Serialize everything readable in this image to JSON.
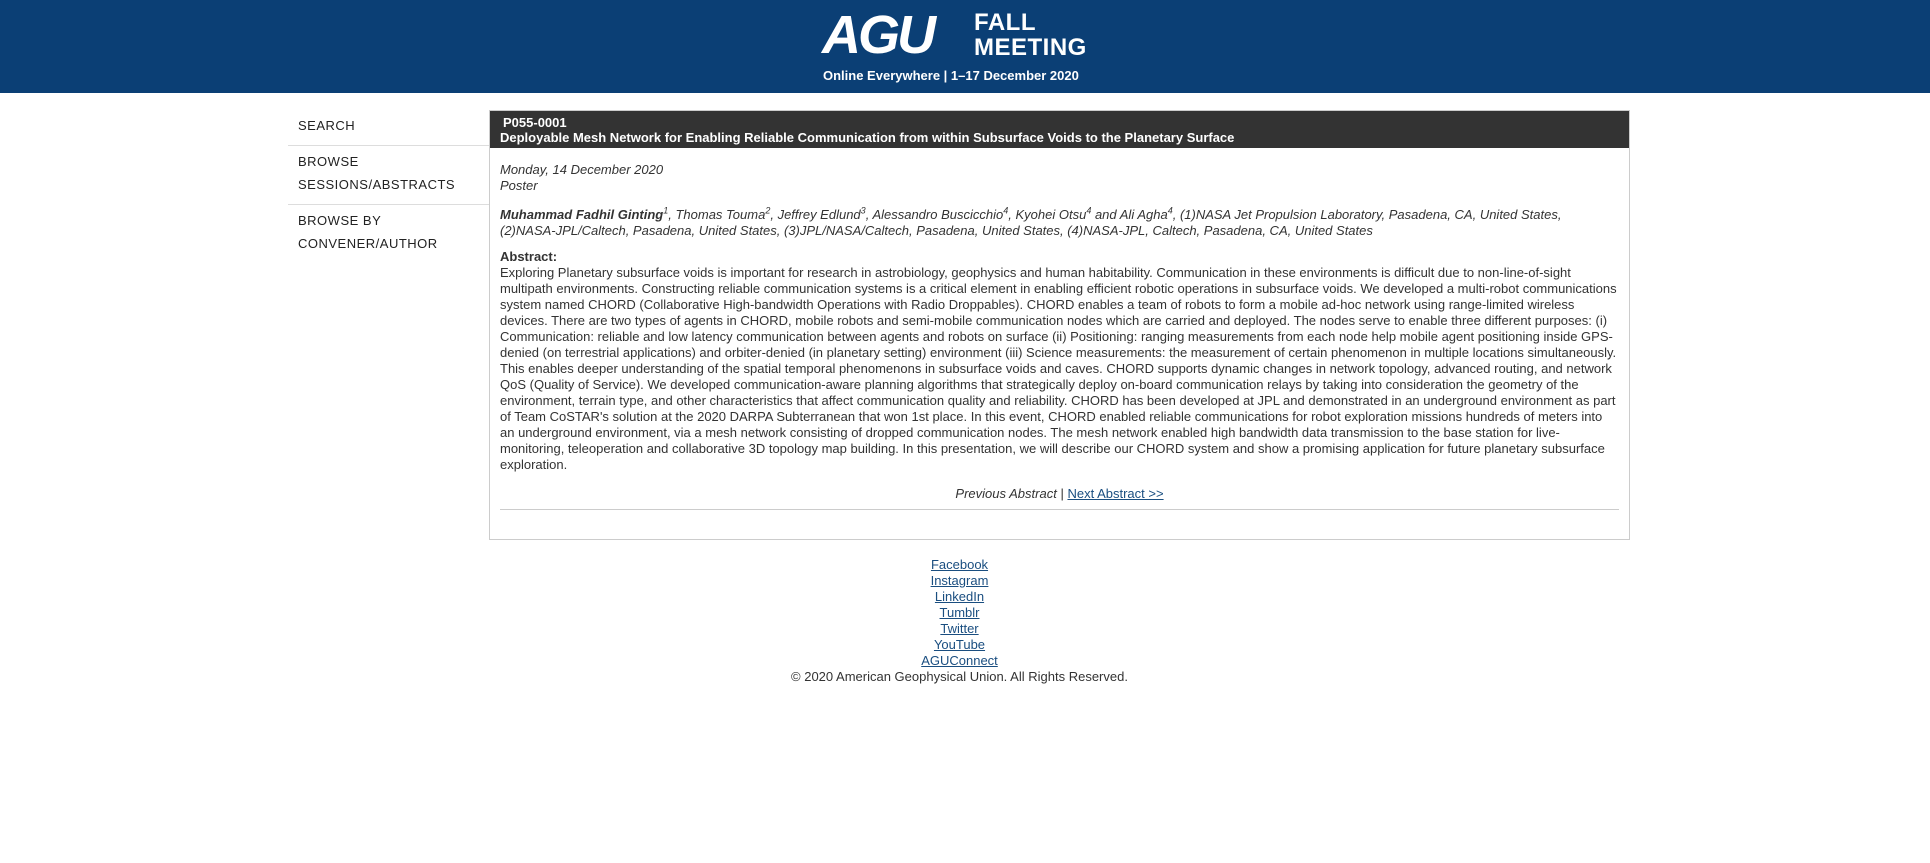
{
  "header": {
    "logo_agu": "AGU",
    "logo_fall": "FALL",
    "logo_meeting": "MEETING",
    "tagline": "Online Everywhere | 1–17 December 2020",
    "background": "#0b3f75"
  },
  "sidebar": {
    "items": [
      {
        "label": "SEARCH"
      },
      {
        "label_line1": "BROWSE",
        "label_line2": "SESSIONS/ABSTRACTS"
      },
      {
        "label_line1": "BROWSE BY",
        "label_line2": "CONVENER/AUTHOR"
      }
    ]
  },
  "abstract": {
    "code": "P055-0001",
    "title": "Deployable Mesh Network for Enabling Reliable Communication from within Subsurface Voids to the Planetary Surface",
    "date": "Monday, 14 December 2020",
    "type": "Poster",
    "authors": [
      {
        "name": "Muhammad Fadhil Ginting",
        "sup": "1"
      },
      {
        "name": "Thomas Touma",
        "sup": "2"
      },
      {
        "name": "Jeffrey Edlund",
        "sup": "3"
      },
      {
        "name": "Alessandro Buscicchio",
        "sup": "4"
      },
      {
        "name": "Kyohei Otsu",
        "sup": "4"
      },
      {
        "name": "Ali Agha",
        "sup": "4"
      }
    ],
    "affiliations": ", (1)NASA Jet Propulsion Laboratory, Pasadena, CA, United States, (2)NASA-JPL/Caltech, Pasadena, United States, (3)JPL/NASA/Caltech, Pasadena, United States, (4)NASA-JPL, Caltech, Pasadena, CA, United States",
    "abstract_label": "Abstract:",
    "abstract_text": "Exploring Planetary subsurface voids is important for research in astrobiology, geophysics and human habitability. Communication in these environments is difficult due to non-line-of-sight multipath environments. Constructing reliable communication systems is a critical element in enabling efficient robotic operations in subsurface voids. We developed a multi-robot communications system named CHORD (Collaborative High-bandwidth Operations with Radio Droppables). CHORD enables a team of robots to form a mobile ad-hoc network using range-limited wireless devices. There are two types of agents in CHORD, mobile robots and semi-mobile communication nodes which are carried and deployed. The nodes serve to enable three different purposes: (i) Communication: reliable and low latency communication between agents and robots on surface (ii) Positioning: ranging measurements from each node help mobile agent positioning inside GPS-denied (on terrestrial applications) and orbiter-denied (in planetary setting) environment (iii) Science measurements: the measurement of certain phenomenon in multiple locations simultaneously. This enables deeper understanding of the spatial temporal phenomenons in subsurface voids and caves. CHORD supports dynamic changes in network topology, advanced routing, and network QoS (Quality of Service). We developed communication-aware planning algorithms that strategically deploy on-board communication relays by taking into consideration the geometry of the environment, terrain type, and other characteristics that affect communication quality and reliability. CHORD has been developed at JPL and demonstrated in an underground environment as part of Team CoSTAR's solution at the 2020 DARPA Subterranean that won 1st place. In this event, CHORD enabled reliable communications for robot exploration missions hundreds of meters into an underground environment, via a mesh network consisting of dropped communication nodes. The mesh network enabled high bandwidth data transmission to the base station for live-monitoring, teleoperation and collaborative 3D topology map building. In this presentation, we will describe our CHORD system and show a promising application for future planetary subsurface exploration.",
    "prev_label": "Previous Abstract",
    "separator": "|",
    "next_label": "Next Abstract >>"
  },
  "footer": {
    "links": [
      "Facebook",
      "Instagram",
      "LinkedIn",
      "Tumblr",
      "Twitter",
      "YouTube",
      "AGUConnect"
    ],
    "copyright": "© 2020 American Geophysical Union. All Rights Reserved."
  }
}
